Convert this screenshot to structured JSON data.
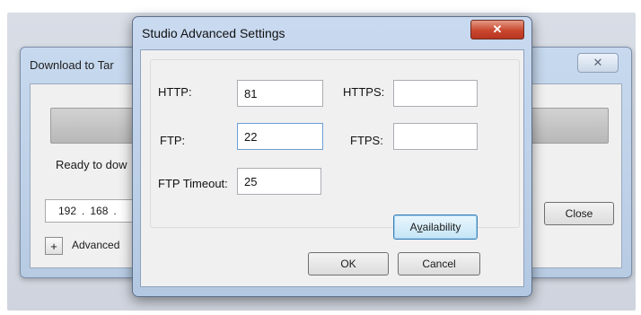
{
  "background_window": {
    "title": "Download to Tar",
    "close_glyph": "✕",
    "status": "Ready to dow",
    "ip": {
      "octet1": "192",
      "octet2": "168",
      "sep": "."
    },
    "close_button": "Close",
    "expand_glyph": "+",
    "advanced_label": "Advanced"
  },
  "dialog": {
    "title": "Studio Advanced Settings",
    "close_glyph": "✕",
    "fields": {
      "http": {
        "label": "HTTP:",
        "value": "81"
      },
      "https": {
        "label": "HTTPS:",
        "value": ""
      },
      "ftp": {
        "label": "FTP:",
        "value": "22"
      },
      "ftps": {
        "label": "FTPS:",
        "value": ""
      },
      "ftp_timeout": {
        "label": "FTP Timeout:",
        "value": "25"
      }
    },
    "availability_button": {
      "prefix": "A",
      "underlined": "v",
      "suffix": "ailability"
    },
    "ok_button": "OK",
    "cancel_button": "Cancel"
  }
}
